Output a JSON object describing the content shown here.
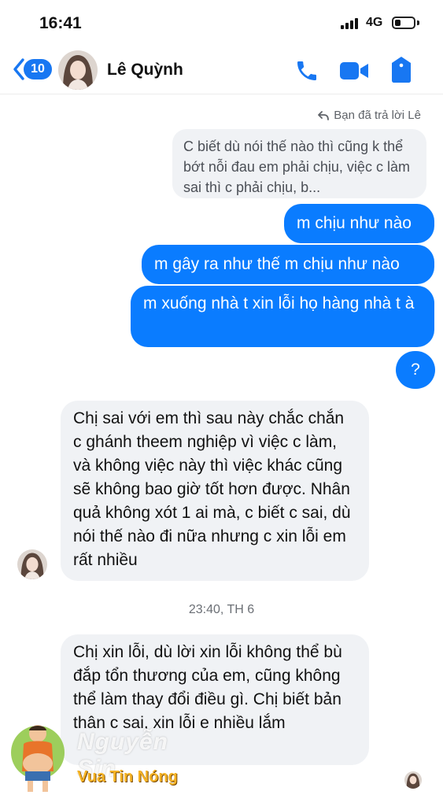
{
  "status_bar": {
    "time": "16:41",
    "network": "4G",
    "battery_level": 0.3
  },
  "header": {
    "back_count": "10",
    "contact_name": "Lê Quỳnh",
    "icons": [
      "phone-icon",
      "video-camera-icon",
      "info-shield-icon"
    ],
    "accent_color": "#1877f2"
  },
  "reply": {
    "note": "Bạn đã trả lời Lê",
    "quoted_text": "C biết dù nói thế nào thì cũng k thể bớt nỗi đau em phải chịu, việc c làm sai thì c phải chịu, b..."
  },
  "messages": [
    {
      "from": "me",
      "text": "m chịu như nào"
    },
    {
      "from": "me",
      "text": "m gây ra như thế m chịu như nào"
    },
    {
      "from": "me",
      "text": "m xuống nhà t xin lỗi họ hàng nhà t à"
    },
    {
      "from": "me",
      "text": "?"
    },
    {
      "from": "them",
      "text": "Chị sai với em thì sau này chắc chắn c ghánh theem nghiệp vì việc c làm, và không việc này thì việc khác cũng sẽ không bao giờ tốt hơn được. Nhân quả không xót 1 ai mà, c biết c sai, dù nói thế nào đi nữa nhưng c xin lỗi em rất nhiều"
    },
    {
      "from": "them",
      "text": "Chị xin lỗi, dù lời xin lỗi không thể bù đắp tổn thương của em, cũng không thể làm thay đổi điều gì. Chị biết bản thân c sai, xin lỗi e nhiều lắm"
    }
  ],
  "timestamp": "23:40, TH 6",
  "watermark": {
    "name": "Nguyễn Sin",
    "tagline": "Vua Tin Nóng"
  },
  "colors": {
    "outgoing_bubble": "#0a7cff",
    "incoming_bubble": "#f0f2f5"
  }
}
